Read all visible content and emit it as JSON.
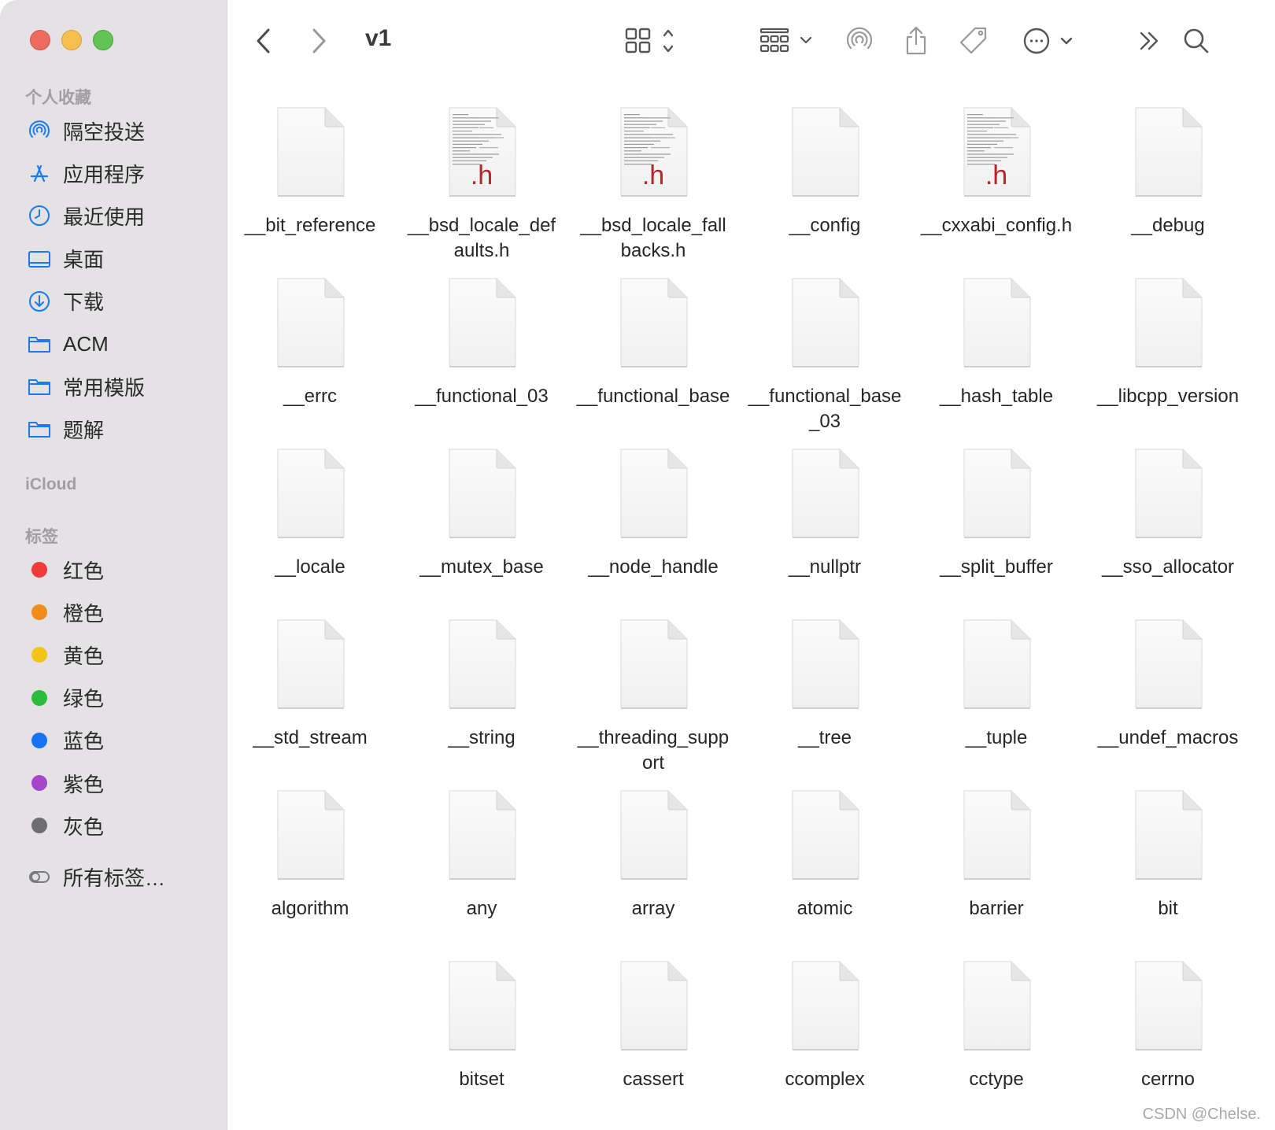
{
  "window": {
    "title": "v1"
  },
  "sidebar": {
    "favorites_title": "个人收藏",
    "favorites": [
      {
        "label": "隔空投送",
        "icon": "airdrop-icon"
      },
      {
        "label": "应用程序",
        "icon": "applications-icon"
      },
      {
        "label": "最近使用",
        "icon": "clock-icon"
      },
      {
        "label": "桌面",
        "icon": "desktop-icon"
      },
      {
        "label": "下载",
        "icon": "download-icon"
      },
      {
        "label": "ACM",
        "icon": "folder-icon"
      },
      {
        "label": "常用模版",
        "icon": "folder-icon"
      },
      {
        "label": "题解",
        "icon": "folder-icon"
      }
    ],
    "icloud_title": "iCloud",
    "tags_title": "标签",
    "tags": [
      {
        "label": "红色",
        "color": "#ef3b3a"
      },
      {
        "label": "橙色",
        "color": "#f08b1c"
      },
      {
        "label": "黄色",
        "color": "#f2c41a"
      },
      {
        "label": "绿色",
        "color": "#2dbb3c"
      },
      {
        "label": "蓝色",
        "color": "#1a72f2"
      },
      {
        "label": "紫色",
        "color": "#a547c8"
      },
      {
        "label": "灰色",
        "color": "#6e6e72"
      }
    ],
    "all_tags": "所有标签…"
  },
  "toolbar": {
    "icons": [
      "back-icon",
      "forward-icon",
      "icon-view-icon",
      "group-icon",
      "airdrop-icon",
      "share-icon",
      "tag-icon",
      "more-icon",
      "overflow-icon",
      "search-icon"
    ]
  },
  "files": [
    {
      "name": "__bit_reference",
      "h": false
    },
    {
      "name": "__bsd_locale_defaults.h",
      "h": true
    },
    {
      "name": "__bsd_locale_fallbacks.h",
      "h": true
    },
    {
      "name": "__config",
      "h": false
    },
    {
      "name": "__cxxabi_config.h",
      "h": true
    },
    {
      "name": "__debug",
      "h": false
    },
    {
      "name": "__errc",
      "h": false
    },
    {
      "name": "__functional_03",
      "h": false
    },
    {
      "name": "__functional_base",
      "h": false
    },
    {
      "name": "__functional_base_03",
      "h": false
    },
    {
      "name": "__hash_table",
      "h": false
    },
    {
      "name": "__libcpp_version",
      "h": false
    },
    {
      "name": "__locale",
      "h": false
    },
    {
      "name": "__mutex_base",
      "h": false
    },
    {
      "name": "__node_handle",
      "h": false
    },
    {
      "name": "__nullptr",
      "h": false
    },
    {
      "name": "__split_buffer",
      "h": false
    },
    {
      "name": "__sso_allocator",
      "h": false
    },
    {
      "name": "__std_stream",
      "h": false
    },
    {
      "name": "__string",
      "h": false
    },
    {
      "name": "__threading_support",
      "h": false
    },
    {
      "name": "__tree",
      "h": false
    },
    {
      "name": "__tuple",
      "h": false
    },
    {
      "name": "__undef_macros",
      "h": false
    },
    {
      "name": "algorithm",
      "h": false
    },
    {
      "name": "any",
      "h": false
    },
    {
      "name": "array",
      "h": false
    },
    {
      "name": "atomic",
      "h": false
    },
    {
      "name": "barrier",
      "h": false
    },
    {
      "name": "bit",
      "h": false
    },
    {
      "name": "",
      "h": false,
      "empty": true
    },
    {
      "name": "bitset",
      "h": false
    },
    {
      "name": "cassert",
      "h": false
    },
    {
      "name": "ccomplex",
      "h": false
    },
    {
      "name": "cctype",
      "h": false
    },
    {
      "name": "cerrno",
      "h": false
    }
  ],
  "file_badge": ".h",
  "watermark": "CSDN @Chelse."
}
